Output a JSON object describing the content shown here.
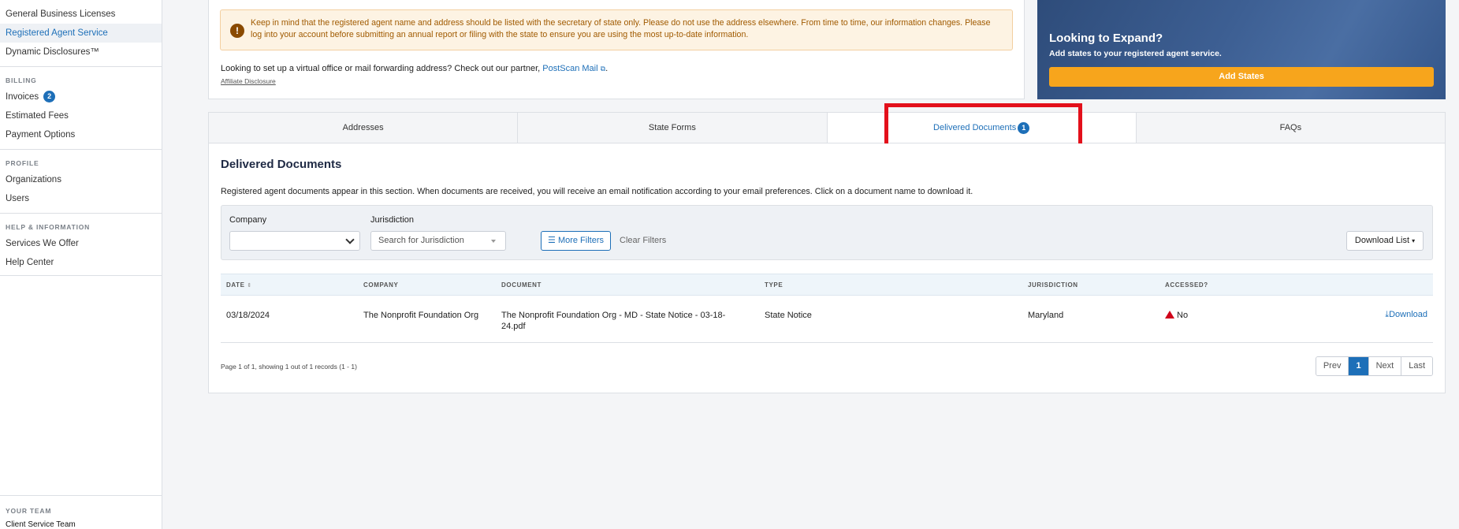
{
  "sidebar": {
    "items_top": [
      {
        "label": "General Business Licenses",
        "active": false
      },
      {
        "label": "Registered Agent Service",
        "active": true
      },
      {
        "label": "Dynamic Disclosures™",
        "active": false
      }
    ],
    "billing": {
      "heading": "BILLING",
      "invoices_label": "Invoices",
      "invoices_count": "2",
      "estimated_fees": "Estimated Fees",
      "payment_options": "Payment Options"
    },
    "profile": {
      "heading": "PROFILE",
      "organizations": "Organizations",
      "users": "Users"
    },
    "help": {
      "heading": "HELP & INFORMATION",
      "services": "Services We Offer",
      "help_center": "Help Center"
    },
    "team": {
      "heading": "YOUR TEAM",
      "name": "Client Service Team"
    }
  },
  "notice": {
    "alert_text": "Keep in mind that the registered agent name and address should be listed with the secretary of state only. Please do not use the address elsewhere. From time to time, our information changes. Please log into your account before submitting an annual report or filing with the state to ensure you are using the most up-to-date information.",
    "partner_prefix": "Looking to set up a virtual office or mail forwarding address? Check out our partner,",
    "partner_link": "PostScan Mail",
    "affiliate": "Affiliate Disclosure"
  },
  "promo": {
    "title": "Looking to Expand?",
    "subtitle": "Add states to your registered agent service.",
    "button": "Add States"
  },
  "tabs": [
    {
      "label": "Addresses"
    },
    {
      "label": "State Forms"
    },
    {
      "label": "Delivered Documents",
      "badge": "1"
    },
    {
      "label": "FAQs"
    }
  ],
  "panel": {
    "title": "Delivered Documents",
    "description": "Registered agent documents appear in this section. When documents are received, you will receive an email notification according to your email preferences. Click on a document name to download it.",
    "filters": {
      "company_label": "Company",
      "company_value": "",
      "jurisdiction_label": "Jurisdiction",
      "jurisdiction_placeholder": "Search for Jurisdiction",
      "more_filters": "More Filters",
      "clear_filters": "Clear Filters",
      "download_list": "Download List"
    },
    "table": {
      "headers": [
        "DATE",
        "COMPANY",
        "DOCUMENT",
        "TYPE",
        "JURISDICTION",
        "ACCESSED?"
      ],
      "rows": [
        {
          "date": "03/18/2024",
          "company": "The Nonprofit Foundation Org",
          "document": "The Nonprofit Foundation Org - MD - State Notice - 03-18-24.pdf",
          "type": "State Notice",
          "jurisdiction": "Maryland",
          "accessed": "No",
          "action": "Download"
        }
      ]
    },
    "pagination": {
      "info": "Page 1 of 1, showing 1 out of 1 records (1 - 1)",
      "prev": "Prev",
      "current": "1",
      "next": "Next",
      "last": "Last"
    }
  },
  "colors": {
    "accent": "#1d6fb8",
    "highlight": "#e3101b",
    "promo_button": "#f7a51c",
    "warning": "#d0021b"
  }
}
